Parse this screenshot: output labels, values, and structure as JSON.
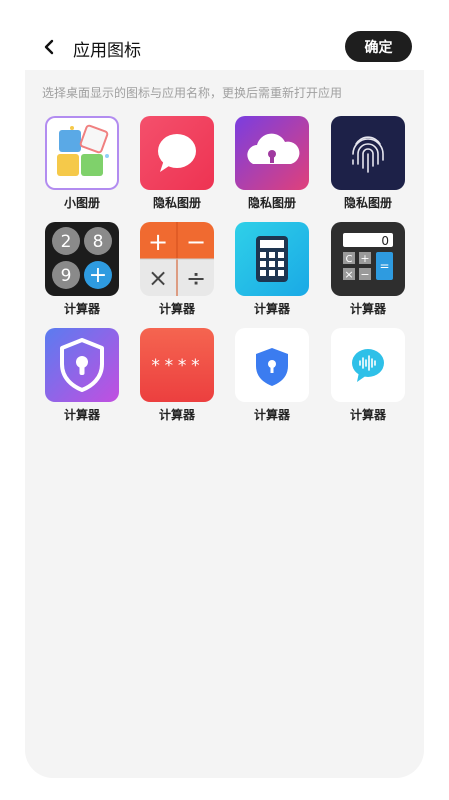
{
  "header": {
    "title": "应用图标",
    "confirm_label": "确定"
  },
  "hint": "选择桌面显示的图标与应用名称，更换后需重新打开应用",
  "apps": [
    {
      "label": "小图册",
      "icon": "puzzle-icon"
    },
    {
      "label": "隐私图册",
      "icon": "chat-bubble-icon"
    },
    {
      "label": "隐私图册",
      "icon": "cloud-lock-icon"
    },
    {
      "label": "隐私图册",
      "icon": "fingerprint-icon"
    },
    {
      "label": "计算器",
      "icon": "number-balls-icon",
      "digits": [
        "2",
        "8",
        "9",
        "+"
      ]
    },
    {
      "label": "计算器",
      "icon": "operator-grid-icon",
      "symbols": [
        "+",
        "−",
        "×",
        "÷"
      ]
    },
    {
      "label": "计算器",
      "icon": "calculator-icon"
    },
    {
      "label": "计算器",
      "icon": "dark-calculator-icon",
      "display": "0",
      "keys": [
        "C",
        "+",
        "×",
        "−",
        "="
      ]
    },
    {
      "label": "计算器",
      "icon": "shield-lock-icon"
    },
    {
      "label": "计算器",
      "icon": "password-dots-icon",
      "mask": "****"
    },
    {
      "label": "计算器",
      "icon": "shield-keyhole-icon"
    },
    {
      "label": "计算器",
      "icon": "voice-bubble-icon"
    }
  ]
}
